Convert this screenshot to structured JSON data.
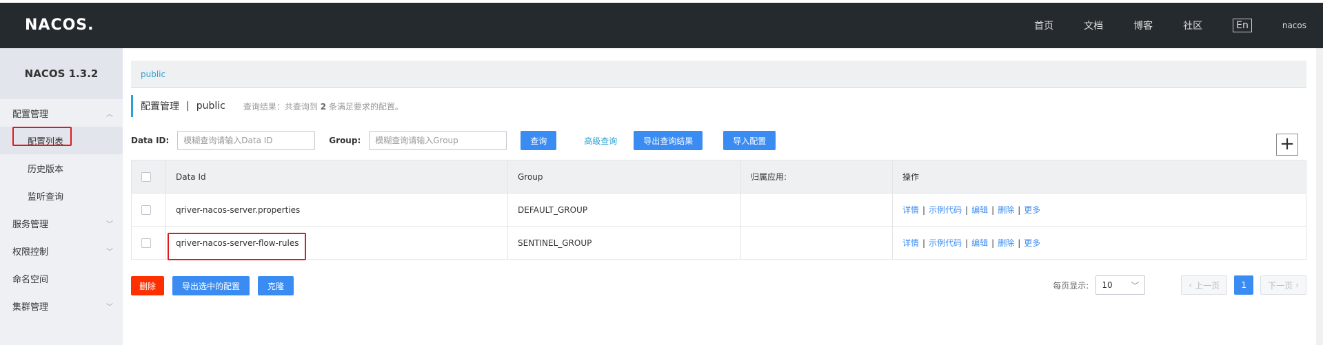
{
  "header": {
    "logo": "NACOS.",
    "nav": [
      "首页",
      "文档",
      "博客",
      "社区"
    ],
    "lang": "En",
    "user": "nacos"
  },
  "sidebar": {
    "version": "NACOS 1.3.2",
    "groups": [
      {
        "label": "配置管理",
        "expanded": true,
        "items": [
          "配置列表",
          "历史版本",
          "监听查询"
        ]
      },
      {
        "label": "服务管理",
        "expanded": false
      },
      {
        "label": "权限控制",
        "expanded": false
      },
      {
        "label": "命名空间"
      },
      {
        "label": "集群管理",
        "expanded": false
      }
    ]
  },
  "main": {
    "namespace_tab": "public",
    "title": "配置管理",
    "separator": "|",
    "namespace": "public",
    "result_prefix": "查询结果：共查询到",
    "result_count": "2",
    "result_suffix": "条满足要求的配置。",
    "search": {
      "dataid_label": "Data ID:",
      "dataid_placeholder": "模糊查询请输入Data ID",
      "group_label": "Group:",
      "group_placeholder": "模糊查询请输入Group",
      "query_btn": "查询",
      "advanced_link": "高级查询",
      "export_btn": "导出查询结果",
      "import_btn": "导入配置",
      "add_btn": "+"
    },
    "table": {
      "headers": [
        "Data Id",
        "Group",
        "归属应用:",
        "操作"
      ],
      "rows": [
        {
          "data_id": "qriver-nacos-server.properties",
          "group": "DEFAULT_GROUP",
          "app": ""
        },
        {
          "data_id": "qriver-nacos-server-flow-rules",
          "group": "SENTINEL_GROUP",
          "app": ""
        }
      ],
      "ops": [
        "详情",
        "示例代码",
        "编辑",
        "删除",
        "更多"
      ],
      "op_separator": "|"
    },
    "bottom": {
      "delete_btn": "删除",
      "export_selected_btn": "导出选中的配置",
      "clone_btn": "克隆",
      "page_size_label": "每页显示:",
      "page_size": "10",
      "prev": "上一页",
      "page": "1",
      "next": "下一页"
    }
  },
  "colors": {
    "topbar": "#252a2f",
    "primary": "#3b8cf2",
    "danger": "#ff3000",
    "link": "#2aa0d4",
    "highlight": "#e0191b"
  }
}
